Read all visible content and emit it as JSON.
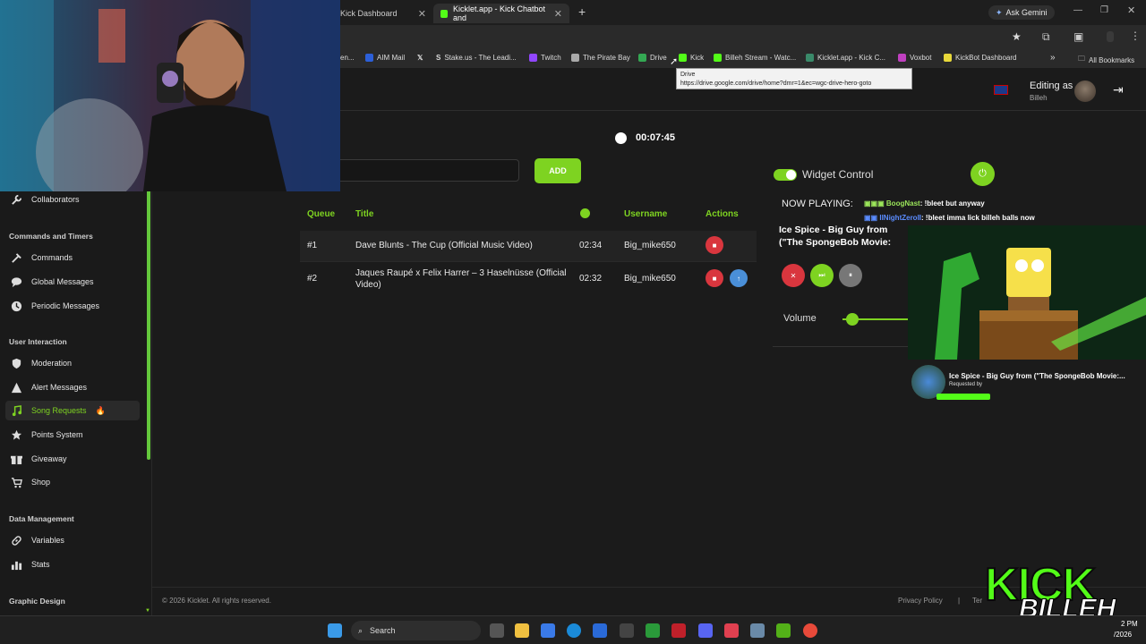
{
  "browser": {
    "tabs": [
      {
        "label": "Kick Dashboard",
        "active": false
      },
      {
        "label": "Kicklet.app - Kick Chatbot and",
        "active": true
      }
    ],
    "new_tab": "+",
    "ask_gemini": "Ask Gemini",
    "bookmarks": [
      "en...",
      "AIM Mail",
      "",
      "Stake.us - The Leadi...",
      "Twitch",
      "The Pirate Bay",
      "Drive",
      "Kick",
      "Billeh Stream - Watc...",
      "Kicklet.app - Kick C...",
      "Voxbot",
      "KickBot Dashboard"
    ],
    "all_bookmarks": "All Bookmarks",
    "tooltip_title": "Drive",
    "tooltip_url": "https://drive.google.com/drive/home?dmr=1&ec=wgc-drive-hero-goto"
  },
  "header": {
    "editing_as": "Editing as",
    "user": "Billeh"
  },
  "timer": "00:07:45",
  "add_button": "ADD",
  "sidebar": {
    "collaborators": "Collaborators",
    "section_commands": "Commands and Timers",
    "commands": "Commands",
    "global_messages": "Global Messages",
    "periodic_messages": "Periodic Messages",
    "section_user": "User Interaction",
    "moderation": "Moderation",
    "alert_messages": "Alert Messages",
    "song_requests": "Song Requests",
    "points_system": "Points System",
    "giveaway": "Giveaway",
    "shop": "Shop",
    "section_data": "Data Management",
    "variables": "Variables",
    "stats": "Stats",
    "section_graphic": "Graphic Design"
  },
  "queue": {
    "headers": {
      "queue": "Queue",
      "title": "Title",
      "username": "Username",
      "actions": "Actions"
    },
    "rows": [
      {
        "queue": "#1",
        "title": "Dave Blunts - The Cup (Official Music Video)",
        "duration": "02:34",
        "username": "Big_mike650"
      },
      {
        "queue": "#2",
        "title": "Jaques Raupé x Felix Harrer – 3 Haselnüsse (Official Video)",
        "duration": "02:32",
        "username": "Big_mike650"
      }
    ]
  },
  "widget": {
    "label": "Widget Control",
    "now_playing_label": "NOW PLAYING:",
    "now_playing_title": "Ice Spice - Big Guy from (\"The SpongeBob Movie: Search for SquareP",
    "volume_label": "Volume",
    "volume": 0.1
  },
  "chat": [
    {
      "user": "BoogNast",
      "message": ": !bleet but anyway",
      "color": "#9be55a"
    },
    {
      "user": "IINightZeroII",
      "message": ": !bleet imma lick billeh balls now",
      "color": "#5a8cff"
    }
  ],
  "overlay": {
    "song_title": "Ice Spice - Big Guy from (\"The SpongeBob Movie:...",
    "requested_by": "Requested by",
    "logo_top": "KICK",
    "logo_bottom": "BILLEH"
  },
  "footer": {
    "copyright": "© 2026 Kicklet. All rights reserved.",
    "privacy": "Privacy Policy",
    "separator": "|",
    "terms": "Ter"
  },
  "taskbar": {
    "search": "Search",
    "time": "2 PM",
    "date": "/2026"
  },
  "colors": {
    "accent": "#7ed321",
    "danger": "#d9363e",
    "info": "#4a8fd8"
  }
}
